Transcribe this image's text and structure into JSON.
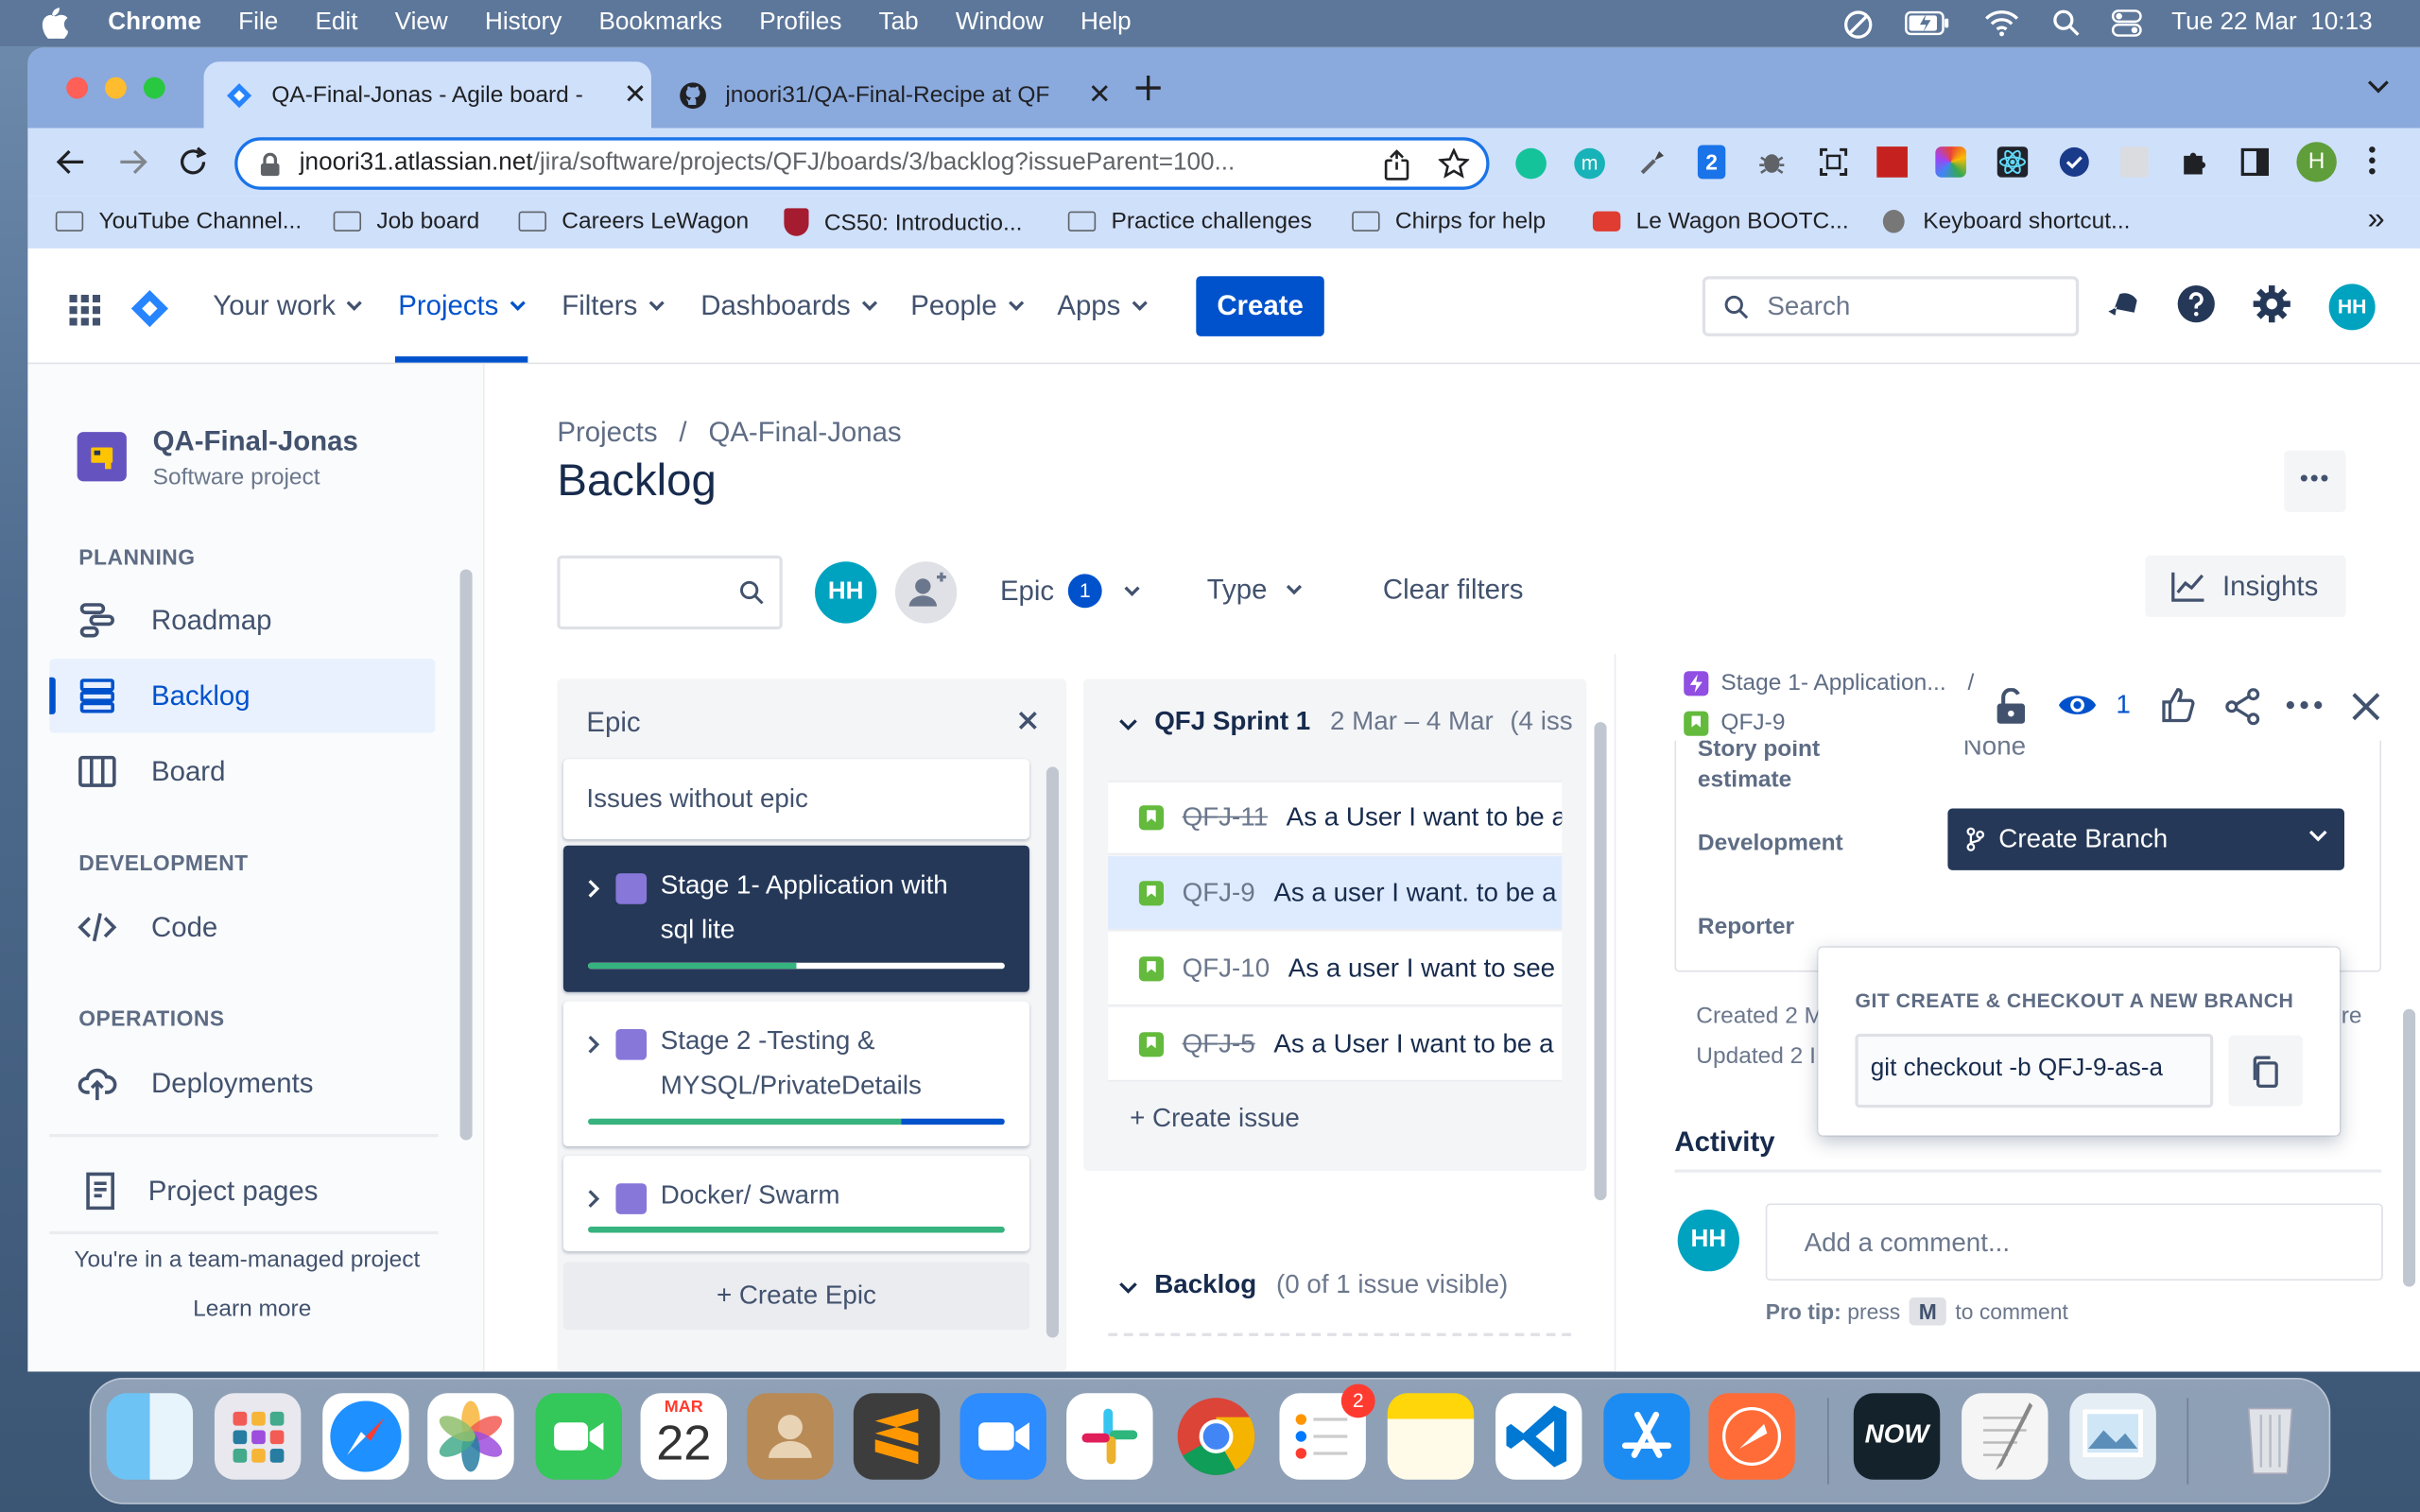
{
  "menubar": {
    "app": "Chrome",
    "items": [
      "File",
      "Edit",
      "View",
      "History",
      "Bookmarks",
      "Profiles",
      "Tab",
      "Window",
      "Help"
    ],
    "clock": "Tue 22 Mar  10:13"
  },
  "tabs": [
    {
      "title": "QA-Final-Jonas - Agile board -",
      "icon": "jira-icon"
    },
    {
      "title": "jnoori31/QA-Final-Recipe at QF",
      "icon": "github-icon"
    }
  ],
  "address": {
    "host": "jnoori31.atlassian.net",
    "path": "/jira/software/projects/QFJ/boards/3/backlog?issueParent=100..."
  },
  "profile_initial": "H",
  "bookmarks": [
    "YouTube Channel...",
    "Job board",
    "Careers LeWagon",
    "CS50: Introductio...",
    "Practice challenges",
    "Chirps for help",
    "Le Wagon BOOTC...",
    "Keyboard shortcut..."
  ],
  "bookmarks_more": "»",
  "jira_nav": {
    "items": [
      "Your work",
      "Projects",
      "Filters",
      "Dashboards",
      "People",
      "Apps"
    ],
    "active": "Projects",
    "create": "Create",
    "search_placeholder": "Search",
    "avatar": "HH"
  },
  "sidebar": {
    "project_name": "QA-Final-Jonas",
    "project_type": "Software project",
    "planning_heading": "PLANNING",
    "planning": [
      "Roadmap",
      "Backlog",
      "Board"
    ],
    "development_heading": "DEVELOPMENT",
    "development": [
      "Code"
    ],
    "operations_heading": "OPERATIONS",
    "operations": [
      "Deployments"
    ],
    "project_pages": "Project pages",
    "team_note": "You're in a team-managed project",
    "learn_more": "Learn more"
  },
  "page": {
    "breadcrumb": [
      "Projects",
      "QA-Final-Jonas"
    ],
    "breadcrumb_sep": "/",
    "title": "Backlog",
    "more": "•••"
  },
  "filters": {
    "avatar": "HH",
    "epic_label": "Epic",
    "epic_count": "1",
    "type_label": "Type",
    "clear": "Clear filters",
    "insights": "Insights"
  },
  "epic_panel": {
    "title": "Epic",
    "issues_without_epic": "Issues without epic",
    "epics": [
      {
        "name": "Stage 1- Application with sql lite",
        "line1": "Stage 1- Application with",
        "line2": "sql lite",
        "progress_done": 0.5,
        "progress_inprogress": 0.0,
        "selected": true
      },
      {
        "name": "Stage 2 -Testing & MYSQL/PrivateDetails",
        "line1": "Stage 2 -Testing &",
        "line2": "MYSQL/PrivateDetails",
        "progress_done": 0.75,
        "progress_inprogress": 0.25,
        "selected": false
      },
      {
        "name": "Docker/ Swarm",
        "line1": "Docker/ Swarm",
        "line2": "",
        "progress_done": 1.0,
        "progress_inprogress": 0.0,
        "selected": false
      }
    ],
    "create_epic": "+ Create Epic"
  },
  "sprint": {
    "name": "QFJ Sprint 1",
    "dates": "2 Mar – 4 Mar",
    "count": "(4 iss",
    "issues": [
      {
        "key": "QFJ-11",
        "summary": "As a User I want to be a",
        "done": true,
        "selected": false
      },
      {
        "key": "QFJ-9",
        "summary": "As a user I want. to be a",
        "done": false,
        "selected": true
      },
      {
        "key": "QFJ-10",
        "summary": "As a user I want to see",
        "done": false,
        "selected": false
      },
      {
        "key": "QFJ-5",
        "summary": "As a User I want to be a",
        "done": true,
        "selected": false
      }
    ],
    "create_issue": "+ Create issue"
  },
  "backlog": {
    "name": "Backlog",
    "visible": "(0 of 1 issue visible)"
  },
  "detail": {
    "parent": "Stage 1- Application...",
    "sep": "/",
    "key": "QFJ-9",
    "watchers": "1",
    "story_points_label_1": "Story point",
    "story_points_label_2": "estimate",
    "story_points_value": "None",
    "development_label": "Development",
    "create_branch": "Create Branch",
    "reporter_label": "Reporter",
    "created": "Created 2 M",
    "updated": "Updated 2 I",
    "configure_fragment": "re",
    "activity": "Activity",
    "comment_avatar": "HH",
    "comment_placeholder": "Add a comment...",
    "pro_tip_label": "Pro tip:",
    "pro_tip_text_1": "press",
    "pro_tip_key": "M",
    "pro_tip_text_2": "to comment"
  },
  "git_popup": {
    "heading": "GIT CREATE & CHECKOUT A NEW BRANCH",
    "command": "git checkout -b QFJ-9-as-a"
  },
  "dock": {
    "calendar_month": "MAR",
    "calendar_day": "22",
    "reminders_badge": "2",
    "now_label": "NOW"
  },
  "colors": {
    "jira_blue": "#0052cc",
    "epic_selected": "#253858",
    "done_green": "#36b37e",
    "progress_blue": "#0052cc",
    "story_green": "#63ba3c",
    "epic_purple": "#8777d9",
    "tab_strip": "#8aa9dd",
    "toolbar": "#cfe0fb"
  }
}
